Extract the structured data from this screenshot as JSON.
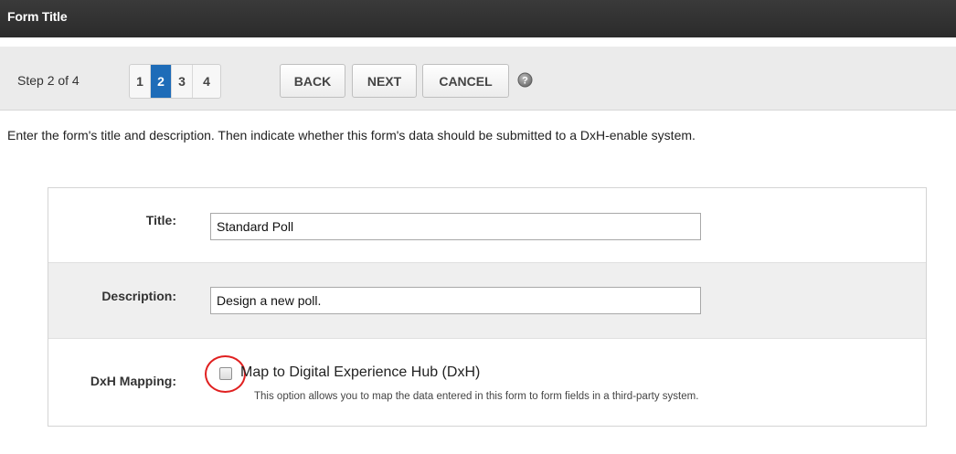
{
  "header": {
    "title": "Form Title"
  },
  "toolbar": {
    "step_label": "Step 2 of 4",
    "steps": [
      {
        "label": "1",
        "active": false
      },
      {
        "label": "2",
        "active": true
      },
      {
        "label": "3",
        "active": false
      },
      {
        "label": "4",
        "active": false
      }
    ],
    "back_label": "BACK",
    "next_label": "NEXT",
    "cancel_label": "CANCEL",
    "help_icon": "help-icon"
  },
  "instructions": "Enter the form's title and description. Then indicate whether this form's data should be submitted to a DxH-enable system.",
  "form": {
    "title": {
      "label": "Title:",
      "value": "Standard Poll"
    },
    "description": {
      "label": "Description:",
      "value": "Design a new poll."
    },
    "dxh": {
      "label": "DxH Mapping:",
      "checkbox_label": "Map to Digital Experience Hub (DxH)",
      "checked": false,
      "help_text": "This option allows you to map the data entered in this form to form fields in a third-party system."
    }
  },
  "colors": {
    "header_bg": "#2f2f2f",
    "active_step": "#1e6cb8",
    "highlight": "#e02020"
  }
}
